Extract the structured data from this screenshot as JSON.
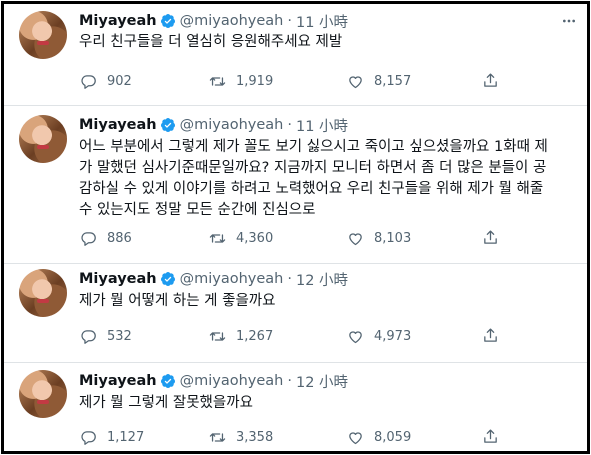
{
  "tweets": [
    {
      "name": "Miyayeah",
      "handle": "@miyaohyeah",
      "dot": "·",
      "time": "11 小時",
      "text": "우리 친구들을 더 열심히 응원해주세요 제발",
      "replies": "902",
      "retweets": "1,919",
      "likes": "8,157"
    },
    {
      "name": "Miyayeah",
      "handle": "@miyaohyeah",
      "dot": "·",
      "time": "11 小時",
      "text": "어느 부분에서 그렇게 제가 꼴도 보기 싫으시고 죽이고 싶으셨을까요 1화때 제가 말했던 심사기준때문일까요? 지금까지 모니터 하면서 좀 더 많은 분들이 공감하실 수 있게 이야기를 하려고 노력했어요 우리 친구들을 위해 제가 뭘 해줄 수 있는지도 정말 모든 순간에 진심으로",
      "replies": "886",
      "retweets": "4,360",
      "likes": "8,103"
    },
    {
      "name": "Miyayeah",
      "handle": "@miyaohyeah",
      "dot": "·",
      "time": "12 小時",
      "text": "제가 뭘 어떻게 하는 게 좋을까요",
      "replies": "532",
      "retweets": "1,267",
      "likes": "4,973"
    },
    {
      "name": "Miyayeah",
      "handle": "@miyaohyeah",
      "dot": "·",
      "time": "12 小時",
      "text": "제가 뭘 그렇게 잘못했을까요",
      "replies": "1,127",
      "retweets": "3,358",
      "likes": "8,059"
    }
  ],
  "colors": {
    "accent": "#1d9bf0",
    "muted": "#536471",
    "text": "#0f1419",
    "border": "#000000"
  },
  "icons": [
    "verified-badge-icon",
    "more-options-icon",
    "reply-icon",
    "retweet-icon",
    "like-icon",
    "share-icon"
  ]
}
